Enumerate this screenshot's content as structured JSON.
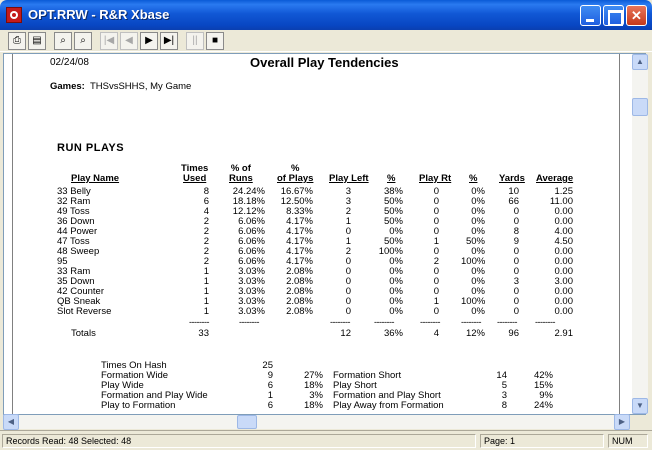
{
  "window": {
    "title": "OPT.RRW - R&R Xbase"
  },
  "toolbar": {
    "buttons": [
      {
        "icon": "print-icon",
        "glyph": "⎙"
      },
      {
        "icon": "page-setup-icon",
        "glyph": "▤"
      },
      {
        "icon": "zoom-in-icon",
        "glyph": "⌕"
      },
      {
        "icon": "zoom-out-icon",
        "glyph": "⌕"
      },
      {
        "icon": "first-page-icon",
        "glyph": "|◀"
      },
      {
        "icon": "prev-page-icon",
        "glyph": "◀"
      },
      {
        "icon": "next-page-icon",
        "glyph": "▶"
      },
      {
        "icon": "last-page-icon",
        "glyph": "▶|"
      },
      {
        "icon": "pause-icon",
        "glyph": "||"
      },
      {
        "icon": "stop-icon",
        "glyph": "■"
      }
    ]
  },
  "report": {
    "date": "02/24/08",
    "title": "Overall Play Tendencies",
    "games_label": "Games:",
    "games_value": "THSvsSHHS, My Game",
    "section_title": "RUN    PLAYS",
    "headers": {
      "play_name": "Play Name",
      "times_used_1": "Times",
      "times_used_2": "Used",
      "pct_runs_1": "% of",
      "pct_runs_2": "Runs",
      "pct_plays_1": "%",
      "pct_plays_2": "of Plays",
      "play_left": "Play Left",
      "pct_left": "%",
      "play_rt": "Play Rt",
      "pct_rt": "%",
      "yards": "Yards",
      "average": "Average"
    },
    "rows": [
      {
        "name": "33 Belly",
        "times": "8",
        "pct_runs": "24.24%",
        "pct_plays": "16.67%",
        "left": "3",
        "pct_left": "38%",
        "rt": "0",
        "pct_rt": "0%",
        "yards": "10",
        "avg": "1.25"
      },
      {
        "name": "32 Ram",
        "times": "6",
        "pct_runs": "18.18%",
        "pct_plays": "12.50%",
        "left": "3",
        "pct_left": "50%",
        "rt": "0",
        "pct_rt": "0%",
        "yards": "66",
        "avg": "11.00"
      },
      {
        "name": "49 Toss",
        "times": "4",
        "pct_runs": "12.12%",
        "pct_plays": "8.33%",
        "left": "2",
        "pct_left": "50%",
        "rt": "0",
        "pct_rt": "0%",
        "yards": "0",
        "avg": "0.00"
      },
      {
        "name": "36 Down",
        "times": "2",
        "pct_runs": "6.06%",
        "pct_plays": "4.17%",
        "left": "1",
        "pct_left": "50%",
        "rt": "0",
        "pct_rt": "0%",
        "yards": "0",
        "avg": "0.00"
      },
      {
        "name": "44 Power",
        "times": "2",
        "pct_runs": "6.06%",
        "pct_plays": "4.17%",
        "left": "0",
        "pct_left": "0%",
        "rt": "0",
        "pct_rt": "0%",
        "yards": "8",
        "avg": "4.00"
      },
      {
        "name": "47 Toss",
        "times": "2",
        "pct_runs": "6.06%",
        "pct_plays": "4.17%",
        "left": "1",
        "pct_left": "50%",
        "rt": "1",
        "pct_rt": "50%",
        "yards": "9",
        "avg": "4.50"
      },
      {
        "name": "48 Sweep",
        "times": "2",
        "pct_runs": "6.06%",
        "pct_plays": "4.17%",
        "left": "2",
        "pct_left": "100%",
        "rt": "0",
        "pct_rt": "0%",
        "yards": "0",
        "avg": "0.00"
      },
      {
        "name": "95",
        "times": "2",
        "pct_runs": "6.06%",
        "pct_plays": "4.17%",
        "left": "0",
        "pct_left": "0%",
        "rt": "2",
        "pct_rt": "100%",
        "yards": "0",
        "avg": "0.00"
      },
      {
        "name": "33 Ram",
        "times": "1",
        "pct_runs": "3.03%",
        "pct_plays": "2.08%",
        "left": "0",
        "pct_left": "0%",
        "rt": "0",
        "pct_rt": "0%",
        "yards": "0",
        "avg": "0.00"
      },
      {
        "name": "35 Down",
        "times": "1",
        "pct_runs": "3.03%",
        "pct_plays": "2.08%",
        "left": "0",
        "pct_left": "0%",
        "rt": "0",
        "pct_rt": "0%",
        "yards": "3",
        "avg": "3.00"
      },
      {
        "name": "42 Counter",
        "times": "1",
        "pct_runs": "3.03%",
        "pct_plays": "2.08%",
        "left": "0",
        "pct_left": "0%",
        "rt": "0",
        "pct_rt": "0%",
        "yards": "0",
        "avg": "0.00"
      },
      {
        "name": "QB Sneak",
        "times": "1",
        "pct_runs": "3.03%",
        "pct_plays": "2.08%",
        "left": "0",
        "pct_left": "0%",
        "rt": "1",
        "pct_rt": "100%",
        "yards": "0",
        "avg": "0.00"
      },
      {
        "name": "Slot Reverse",
        "times": "1",
        "pct_runs": "3.03%",
        "pct_plays": "2.08%",
        "left": "0",
        "pct_left": "0%",
        "rt": "0",
        "pct_rt": "0%",
        "yards": "0",
        "avg": "0.00"
      }
    ],
    "dashes": "--------",
    "totals": {
      "label": "Totals",
      "times": "33",
      "left": "12",
      "pct_left": "36%",
      "rt": "4",
      "pct_rt": "12%",
      "yards": "96",
      "avg": "2.91"
    },
    "hash_left": [
      {
        "label": "Times On Hash",
        "count": "25",
        "pct": ""
      },
      {
        "label": "Formation Wide",
        "count": "9",
        "pct": "27%"
      },
      {
        "label": "Play Wide",
        "count": "6",
        "pct": "18%"
      },
      {
        "label": "Formation and Play Wide",
        "count": "1",
        "pct": "3%"
      },
      {
        "label": "Play to Formation",
        "count": "6",
        "pct": "18%"
      }
    ],
    "hash_right": [
      {
        "label": "Formation Short",
        "count": "14",
        "pct": "42%"
      },
      {
        "label": "Play Short",
        "count": "5",
        "pct": "15%"
      },
      {
        "label": "Formation and Play Short",
        "count": "3",
        "pct": "9%"
      },
      {
        "label": "Play Away from Formation",
        "count": "8",
        "pct": "24%"
      }
    ]
  },
  "status": {
    "records": "Records Read: 48   Selected: 48",
    "page": "Page:  1",
    "num": "NUM"
  }
}
